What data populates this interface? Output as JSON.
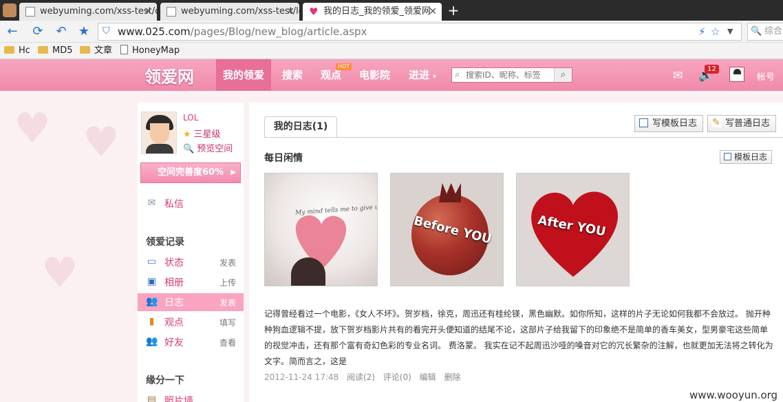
{
  "browser": {
    "tabs": [
      {
        "title": "webyuming.com/xss-test/c"
      },
      {
        "title": "webyuming.com/xss-test/lc"
      },
      {
        "title": "我的日志_我的领爱_领爱网"
      }
    ],
    "new_tab": "+",
    "url_host": "www.025.com",
    "url_path": "/pages/Blog/new_blog/article.aspx",
    "search_placeholder": "综合",
    "bookmarks": [
      "Hc",
      "MD5",
      "文章",
      "HoneyMap"
    ]
  },
  "site": {
    "logo": "领爱网",
    "nav": [
      "我的领爱",
      "搜索",
      "观点",
      "电影院",
      "进进"
    ],
    "hot_badge": "HOT",
    "search_placeholder": "搜索ID、昵称、标签",
    "notify_count": "12",
    "account": "帐号"
  },
  "sidebar": {
    "username": "LOL",
    "level": "三星级",
    "preview": "预览空间",
    "completion": "空间完善度60%",
    "messages": "私信",
    "record_heading": "领爱记录",
    "records": [
      {
        "label": "状态",
        "action": "发表",
        "icon": "status-icon"
      },
      {
        "label": "相册",
        "action": "上传",
        "icon": "album-icon"
      },
      {
        "label": "日志",
        "action": "发表",
        "icon": "diary-icon"
      },
      {
        "label": "观点",
        "action": "填写",
        "icon": "opinion-icon"
      },
      {
        "label": "好友",
        "action": "查看",
        "icon": "friends-icon"
      }
    ],
    "fate_heading": "缘分一下",
    "fate_item": "照片墙"
  },
  "main": {
    "tab": "我的日志(1)",
    "write_template": "写模板日志",
    "write_normal": "写普通日志",
    "post_title": "每日闲情",
    "template_badge": "模板日志",
    "photos": [
      {
        "caption": "My mind tells me to give up, but my heart won't let me",
        "name": "heart-photo"
      },
      {
        "caption": "Before YOU",
        "name": "pomegranate-photo"
      },
      {
        "caption": "After YOU",
        "name": "seeds-heart-photo"
      }
    ],
    "body": "记得曾经看过一个电影，《女人不坏》。贺岁档，徐克，周迅还有桂纶镁，黑色幽默。如你所知，这样的片子无论如何我都不会放过。 抛开种种狗血逻辑不提，放下贺岁档影片共有的看完开头便知道的结尾不论，这部片子给我留下的印象绝不是简单的香车美女，型男豪宅这些简单的视觉冲击，还有那个富有奇幻色彩的专业名词。 费洛蒙。 我实在记不起周迅沙哑的嗓音对它的冗长繁杂的注解，也就更加无法将之转化为文字。简而言之，这是",
    "date": "2012-11-24 17:48",
    "read": "阅读(2)",
    "comments": "评论(0)",
    "edit": "编辑",
    "delete": "删除"
  },
  "watermark": "www.wooyun.org"
}
